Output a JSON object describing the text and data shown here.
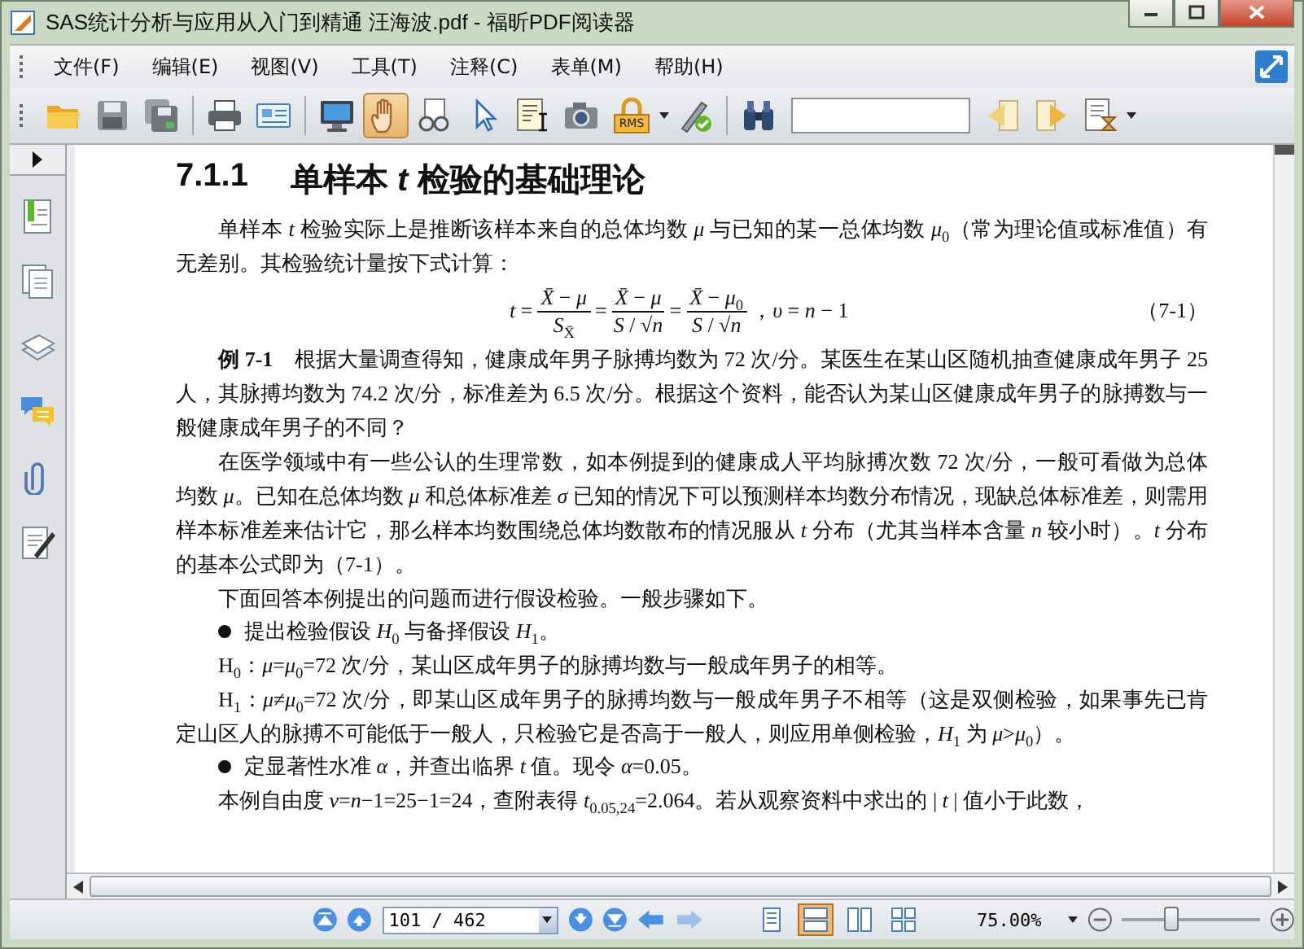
{
  "window": {
    "title": "SAS统计分析与应用从入门到精通 汪海波.pdf - 福昕PDF阅读器"
  },
  "menu": [
    {
      "label": "文件(F)"
    },
    {
      "label": "编辑(E)"
    },
    {
      "label": "视图(V)"
    },
    {
      "label": "工具(T)"
    },
    {
      "label": "注释(C)"
    },
    {
      "label": "表单(M)"
    },
    {
      "label": "帮助(H)"
    }
  ],
  "toolbar": [
    {
      "kind": "monitor",
      "selected": false
    },
    {
      "kind": "hand",
      "selected": true
    },
    {
      "kind": "glasses",
      "selected": false
    },
    {
      "kind": "pointer",
      "selected": false
    },
    {
      "kind": "text-select",
      "selected": false
    },
    {
      "kind": "camera",
      "selected": false
    },
    {
      "kind": "rms",
      "label": "RMS",
      "selected": false
    }
  ],
  "document": {
    "heading": {
      "number": "7.1.1",
      "title": "单样本 *t* 检验的基础理论"
    },
    "blocks": [
      {
        "kind": "paragraph",
        "text": "单样本 *t* 检验实际上是推断该样本来自的总体均数 *μ* 与已知的某一总体均数 *μ*$_{0}$（常为理论值或标准值）有无差别。其检验统计量按下式计算："
      },
      {
        "kind": "formula",
        "lhs": "*t* =",
        "fractions": [
          {
            "num": "*X̄* − *μ*",
            "den": "*S*$_{X̄}$",
            "after": "="
          },
          {
            "num": "*X̄* − *μ*",
            "den": "*S* / √*n*",
            "after": "="
          },
          {
            "num": "*X̄* − *μ*$_{0}$",
            "den": "*S* / √*n*",
            "after": "，*υ* = *n* − 1"
          }
        ],
        "number": "（7-1）"
      },
      {
        "kind": "paragraph",
        "text": "**例 7-1**　根据大量调查得知，健康成年男子脉搏均数为 72 次/分。某医生在某山区随机抽查健康成年男子 25 人，其脉搏均数为 74.2 次/分，标准差为 6.5 次/分。根据这个资料，能否认为某山区健康成年男子的脉搏数与一般健康成年男子的不同？"
      },
      {
        "kind": "paragraph",
        "text": "在医学领域中有一些公认的生理常数，如本例提到的健康成人平均脉搏次数 72 次/分，一般可看做为总体均数 *μ*。已知在总体均数 *μ* 和总体标准差 *σ* 已知的情况下可以预测样本均数分布情况，现缺总体标准差，则需用样本标准差来估计它，那么样本均数围绕总体均数散布的情况服从 *t* 分布（尤其当样本含量 *n* 较小时）。*t* 分布的基本公式即为（7-1）。"
      },
      {
        "kind": "paragraph",
        "text": "下面回答本例提出的问题而进行假设检验。一般步骤如下。"
      },
      {
        "kind": "bullet",
        "text": "提出检验假设 *H*$_{0}$ 与备择假设 *H*$_{1}$。"
      },
      {
        "kind": "paragraph",
        "text": "H$_{0}$：*μ*=*μ*$_{0}$=72 次/分，某山区成年男子的脉搏均数与一般成年男子的相等。"
      },
      {
        "kind": "paragraph",
        "text": "H$_{1}$：*μ*≠*μ*$_{0}$=72 次/分，即某山区成年男子的脉搏均数与一般成年男子不相等（这是双侧检验，如果事先已肯定山区人的脉搏不可能低于一般人，只检验它是否高于一般人，则应用单侧检验，*H*$_{1}$ 为 *μ*>*μ*$_{0}$）。"
      },
      {
        "kind": "bullet",
        "text": "定显著性水准 *α*，并查出临界 *t* 值。现令 *α*=0.05。"
      },
      {
        "kind": "paragraph",
        "text": "本例自由度 *ν*=*n*−1=25−1=24，查附表得 *t*$_{0.05,24}$=2.064。若从观察资料中求出的 | *t* | 值小于此数，"
      }
    ]
  },
  "status_bar": {
    "page": "101 / 462",
    "history": [
      {
        "kind": "back",
        "disabled": false
      },
      {
        "kind": "forward",
        "disabled": true
      }
    ],
    "views": [
      {
        "kind": "single",
        "selected": false
      },
      {
        "kind": "continuous",
        "selected": true
      },
      {
        "kind": "facing",
        "selected": false
      },
      {
        "kind": "grid",
        "selected": false
      }
    ],
    "zoom": "75.00%",
    "zoom_slider": {
      "level": 0.35
    }
  }
}
